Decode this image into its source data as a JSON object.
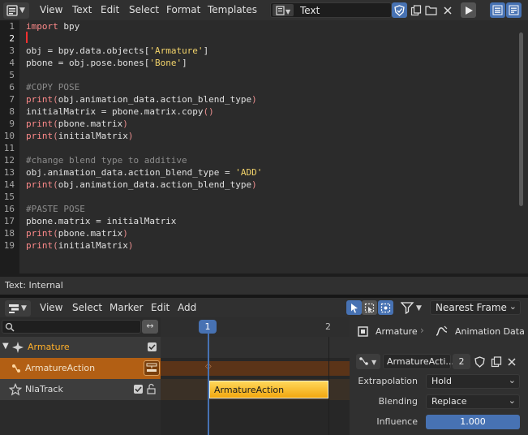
{
  "text_editor": {
    "menus": [
      "View",
      "Text",
      "Edit",
      "Select",
      "Format",
      "Templates"
    ],
    "textblock_name": "Text",
    "lines": [
      {
        "n": "1",
        "html": "<span class='kw'>import</span> bpy"
      },
      {
        "n": "2",
        "html": ""
      },
      {
        "n": "3",
        "html": "obj = bpy.data.objects[<span class='str'>'Armature'</span>]"
      },
      {
        "n": "4",
        "html": "pbone = obj.pose.bones[<span class='str'>'Bone'</span>]"
      },
      {
        "n": "5",
        "html": ""
      },
      {
        "n": "6",
        "html": "<span class='cm'>#COPY POSE</span>"
      },
      {
        "n": "7",
        "html": "<span class='kw'>print</span><span class='pa'>(</span>obj.animation_data.action_blend_type<span class='pa'>)</span>"
      },
      {
        "n": "8",
        "html": "initialMatrix = pbone.matrix.copy<span class='pa'>()</span>"
      },
      {
        "n": "9",
        "html": "<span class='kw'>print</span><span class='pa'>(</span>pbone.matrix<span class='pa'>)</span>"
      },
      {
        "n": "10",
        "html": "<span class='kw'>print</span><span class='pa'>(</span>initialMatrix<span class='pa'>)</span>"
      },
      {
        "n": "11",
        "html": ""
      },
      {
        "n": "12",
        "html": "<span class='cm'>#change blend type to additive</span>"
      },
      {
        "n": "13",
        "html": "obj.animation_data.action_blend_type = <span class='str'>'ADD'</span>"
      },
      {
        "n": "14",
        "html": "<span class='kw'>print</span><span class='pa'>(</span>obj.animation_data.action_blend_type<span class='pa'>)</span>"
      },
      {
        "n": "15",
        "html": ""
      },
      {
        "n": "16",
        "html": "<span class='cm'>#PASTE POSE</span>"
      },
      {
        "n": "17",
        "html": "pbone.matrix = initialMatrix"
      },
      {
        "n": "18",
        "html": "<span class='kw'>print</span><span class='pa'>(</span>pbone.matrix<span class='pa'>)</span>"
      },
      {
        "n": "19",
        "html": "<span class='kw'>print</span><span class='pa'>(</span>initialMatrix<span class='pa'>)</span>"
      }
    ],
    "current_line": "2",
    "status": "Text: Internal"
  },
  "nla_editor": {
    "menus": [
      "View",
      "Select",
      "Marker",
      "Edit",
      "Add"
    ],
    "snap_mode": "Nearest Frame",
    "search_placeholder": "",
    "channels": {
      "armature": "Armature",
      "action": "ArmatureAction",
      "track": "NlaTrack"
    },
    "current_frame": "1",
    "frame_tick_2": "2",
    "strip_label": "ArmatureAction"
  },
  "sidebar": {
    "breadcrumb_object": "Armature",
    "breadcrumb_data": "Animation Data",
    "action_name": "ArmatureActi...",
    "action_users": "2",
    "properties": {
      "extrapolation_label": "Extrapolation",
      "extrapolation_value": "Hold",
      "blending_label": "Blending",
      "blending_value": "Replace",
      "influence_label": "Influence",
      "influence_value": "1.000"
    }
  },
  "colors": {
    "accent": "#4772b3",
    "action_row": "#b25f14",
    "strip": "#f2a70f"
  }
}
